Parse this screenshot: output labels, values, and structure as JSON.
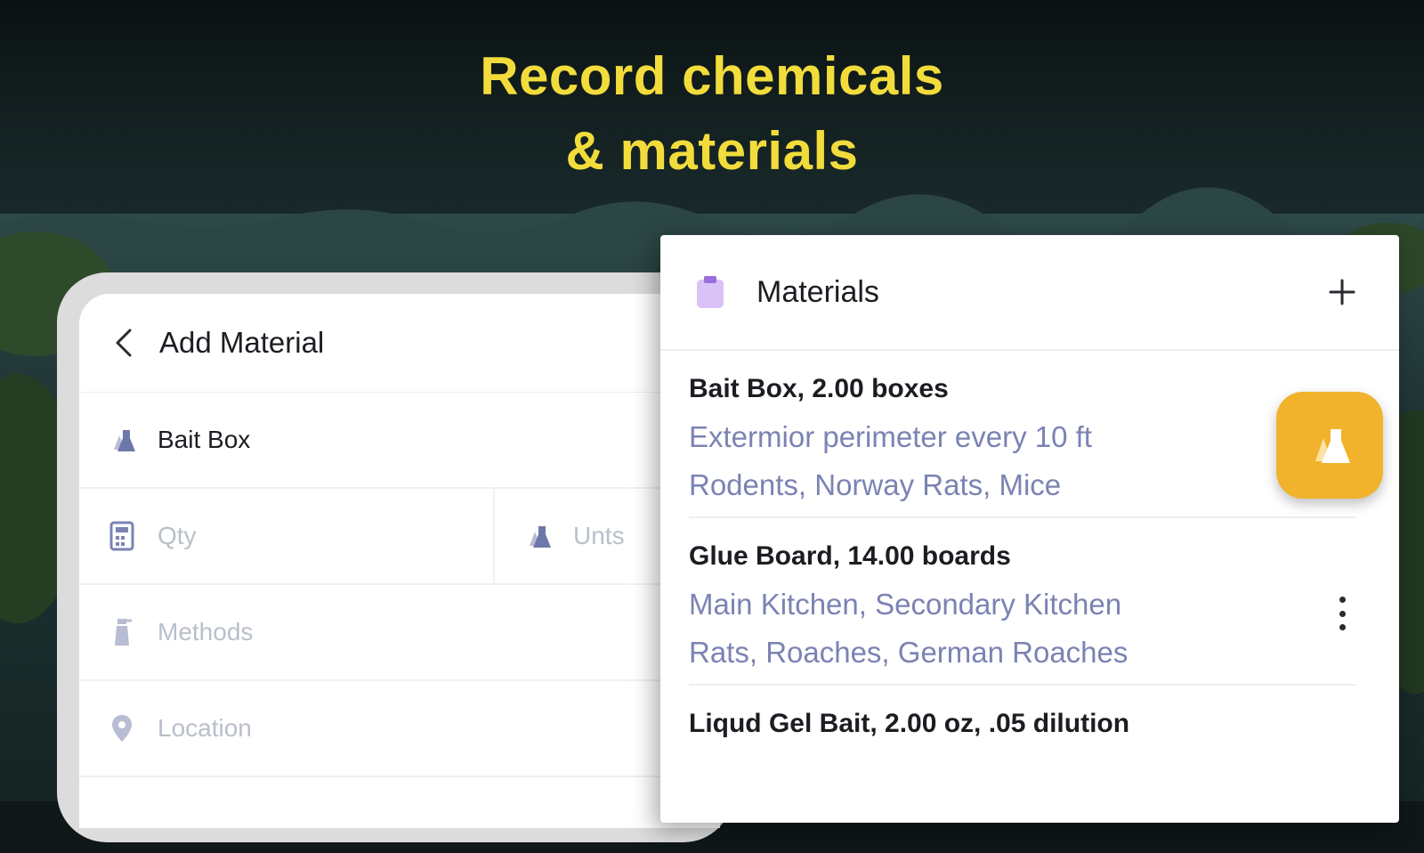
{
  "headline": {
    "line1": "Record chemicals",
    "line2": "& materials"
  },
  "add_material": {
    "title": "Add Material",
    "fields": {
      "material": {
        "value": "Bait Box",
        "icon": "flask-icon"
      },
      "qty": {
        "placeholder": "Qty",
        "icon": "calculator-icon"
      },
      "units": {
        "placeholder": "Unts",
        "icon": "flask-icon"
      },
      "methods": {
        "placeholder": "Methods",
        "icon": "spray-bottle-icon"
      },
      "location": {
        "placeholder": "Location",
        "icon": "location-pin-icon"
      }
    }
  },
  "materials": {
    "title": "Materials",
    "icon": "clipboard-icon",
    "items": [
      {
        "name": "Bait Box, 2.00 boxes",
        "line1": "Extermior perimeter every 10 ft",
        "line2": "Rodents, Norway Rats, Mice"
      },
      {
        "name": "Glue Board, 14.00 boards",
        "line1": "Main Kitchen, Secondary Kitchen",
        "line2": "Rats, Roaches, German Roaches"
      },
      {
        "name": "Liqud Gel Bait, 2.00 oz, .05 dilution",
        "line1": "",
        "line2": ""
      }
    ]
  },
  "colors": {
    "headline": "#f2dc3c",
    "accent": "#f1b32c",
    "subtext": "#7b83b3",
    "clipboard": "#c9a8ef"
  }
}
